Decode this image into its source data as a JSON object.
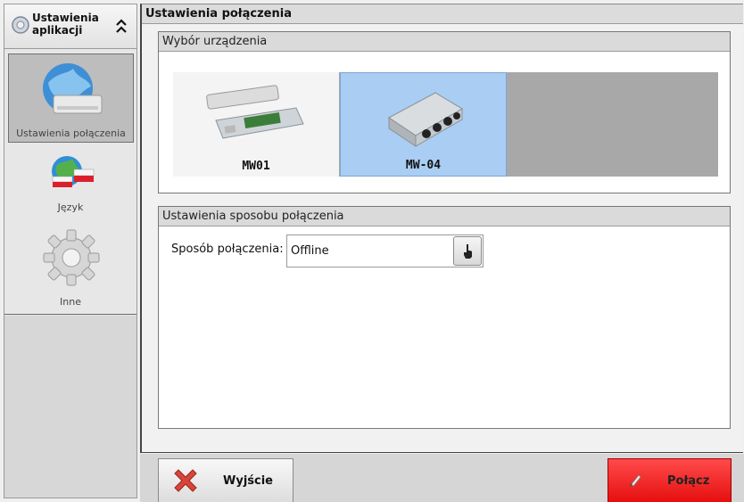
{
  "sidebar": {
    "header_title": "Ustawienia\naplikacji",
    "items": [
      {
        "label": "Ustawienia połączenia",
        "icon": "network-globe-icon"
      },
      {
        "label": "Język",
        "icon": "language-globe-flag-icon"
      },
      {
        "label": "Inne",
        "icon": "gear-icon"
      }
    ]
  },
  "main": {
    "title": "Ustawienia połączenia",
    "device_group": {
      "title": "Wybór urządzenia",
      "devices": [
        {
          "name": "MW01",
          "selected": false
        },
        {
          "name": "MW-04",
          "selected": true
        }
      ]
    },
    "connection_group": {
      "title": "Ustawienia sposobu połączenia",
      "field_label": "Sposób połączenia:",
      "field_value": "Offline"
    }
  },
  "buttons": {
    "exit": "Wyjście",
    "connect": "Połącz"
  },
  "colors": {
    "selected_device_bg": "#a9cdf3",
    "connect_button": "#e60f0f"
  }
}
